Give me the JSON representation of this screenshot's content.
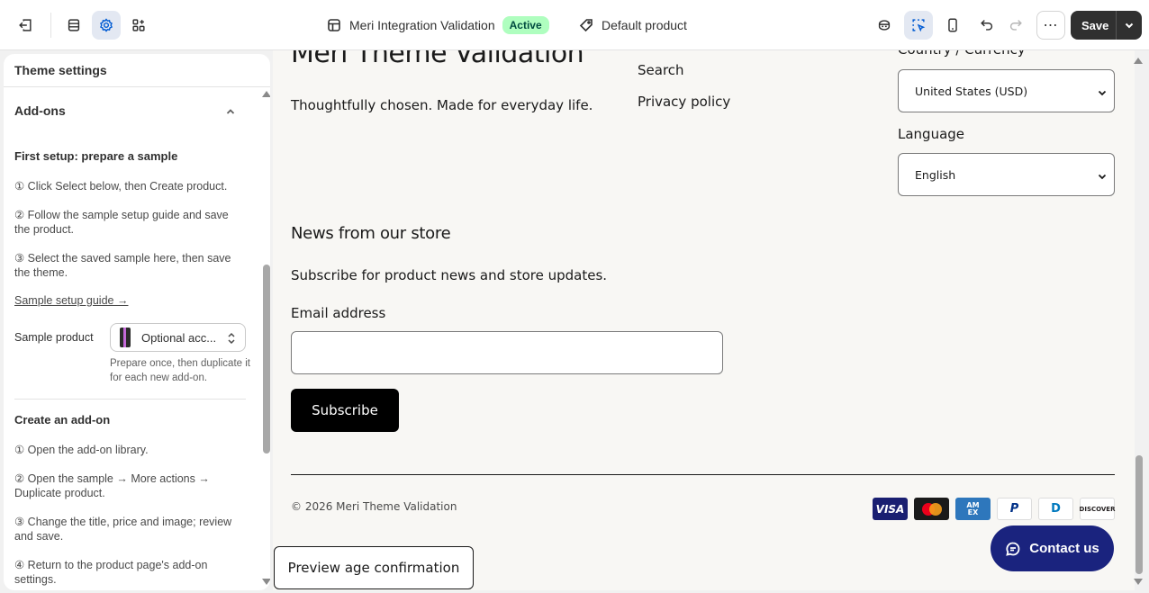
{
  "topbar": {
    "theme_name": "Meri Integration Validation",
    "status_badge": "Active",
    "template": "Default product",
    "save_label": "Save",
    "more_label": "⋯",
    "icons": {
      "exit": "exit-icon",
      "sections": "sections-icon",
      "theme_settings": "gear-icon",
      "app_embeds": "apps-icon",
      "inspector": "inspector-icon",
      "select": "select-icon",
      "mobile": "mobile-icon",
      "undo": "undo-icon",
      "redo": "redo-icon"
    },
    "accent_color": "#005bd3",
    "badge_color": "#affebf"
  },
  "panel": {
    "title": "Theme settings",
    "section_heading": "Add-ons",
    "first_setup": {
      "heading": "First setup: prepare a sample",
      "steps": [
        "① Click Select below, then Create product.",
        "② Follow the sample setup guide and save the product.",
        "③ Select the saved sample here, then save the theme."
      ],
      "guide_link": "Sample setup guide →"
    },
    "sample_product": {
      "label": "Sample product",
      "value": "Optional acc...",
      "help": "Prepare once, then duplicate it for each new add-on."
    },
    "create_addon": {
      "heading": "Create an add-on",
      "steps": [
        "① Open the add-on library.",
        "② Open the sample → More actions → Duplicate product.",
        "③ Change the title, price and image; review and save.",
        "④ Return to the product page's add-on settings."
      ]
    }
  },
  "preview": {
    "store_title": "Meri Theme Validation",
    "tagline": "Thoughtfully chosen. Made for everyday life.",
    "footer_links": [
      "Search",
      "Privacy policy"
    ],
    "country_label": "Country / Currency",
    "country_value": "United States (USD)",
    "language_label": "Language",
    "language_value": "English",
    "newsletter_heading": "News from our store",
    "newsletter_sub": "Subscribe for product news and store updates.",
    "email_label": "Email address",
    "email_value": "",
    "subscribe_label": "Subscribe",
    "copyright": "© 2026 Meri Theme Validation",
    "payments": [
      "VISA",
      "",
      "AM EX",
      "P",
      "D",
      "DISCOVER"
    ],
    "age_button": "Preview age confirmation",
    "contact_button": "Contact us",
    "contact_color": "#1a237e"
  }
}
